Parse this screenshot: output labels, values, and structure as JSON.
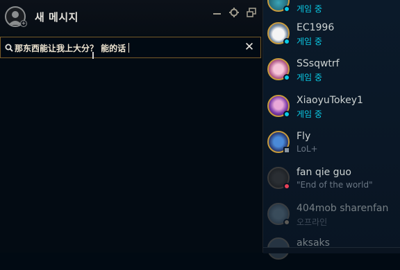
{
  "chat": {
    "title": "새 메시지",
    "search_value": "那东西能让我上大分？ 能的话"
  },
  "colors": {
    "gold_border": "#785a28",
    "online_blue": "#0acbe6",
    "offline_grey": "#6a7684",
    "away_red": "#e84057"
  },
  "friends": [
    {
      "name": "",
      "status": "게임 중",
      "state": "ingame"
    },
    {
      "name": "EC1996",
      "status": "게임 중",
      "state": "ingame"
    },
    {
      "name": "SSsqwtrf",
      "status": "게임 중",
      "state": "ingame"
    },
    {
      "name": "XiaoyuTokey1",
      "status": "게임 중",
      "state": "ingame"
    },
    {
      "name": "Fly",
      "status": "LoL+",
      "state": "mobile"
    },
    {
      "name": "fan qie guo",
      "status": "\"End of the world\"",
      "state": "away"
    },
    {
      "name": "404mob sharenfan",
      "status": "오프라인",
      "state": "offline"
    },
    {
      "name": "aksaks",
      "status": "",
      "state": "offline"
    }
  ]
}
